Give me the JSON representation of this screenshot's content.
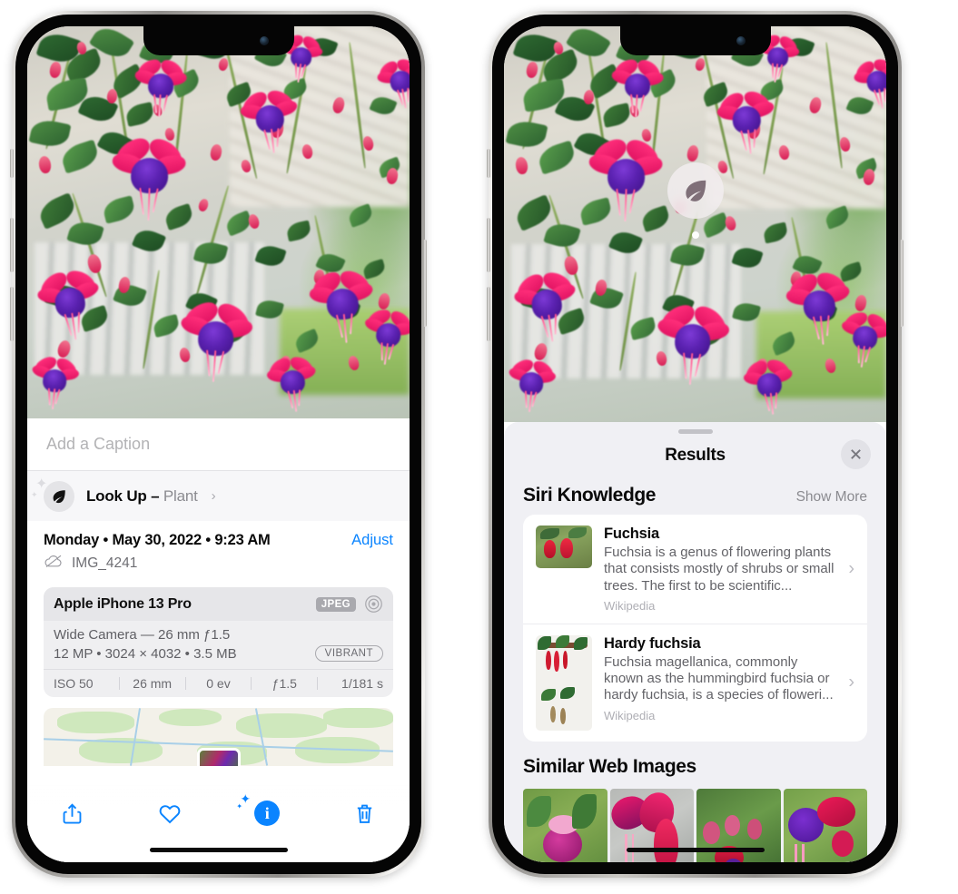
{
  "left_phone": {
    "caption_placeholder": "Add a Caption",
    "lookup": {
      "label": "Look Up – ",
      "category": "Plant",
      "chevron": "›",
      "icon": "leaf-icon"
    },
    "meta": {
      "date": "Monday • May 30, 2022 • 9:23 AM",
      "adjust_label": "Adjust",
      "filename": "IMG_4241",
      "cloud_icon": "icloud-slash-icon"
    },
    "exif": {
      "device": "Apple iPhone 13 Pro",
      "format_badge": "JPEG",
      "lens_icon": "lens-circle-icon",
      "lens_line": "Wide Camera — 26 mm ƒ1.5",
      "size_line": "12 MP • 3024 × 4032 • 3.5 MB",
      "style_badge": "VIBRANT",
      "stats": [
        "ISO 50",
        "26 mm",
        "0 ev",
        "ƒ1.5",
        "1/181 s"
      ]
    },
    "toolbar": {
      "share_label": "Share",
      "favorite_label": "Favorite",
      "info_label": "Info",
      "info_glyph": "i",
      "trash_label": "Delete"
    }
  },
  "right_phone": {
    "pin": {
      "icon": "leaf-icon"
    },
    "sheet": {
      "title": "Results",
      "close_label": "Close",
      "grabber": "drag-handle"
    },
    "siri_knowledge": {
      "heading": "Siri Knowledge",
      "show_more": "Show More",
      "items": [
        {
          "title": "Fuchsia",
          "description": "Fuchsia is a genus of flowering plants that consists mostly of shrubs or small trees. The first to be scientific...",
          "source": "Wikipedia",
          "chevron": "›"
        },
        {
          "title": "Hardy fuchsia",
          "description": "Fuchsia magellanica, commonly known as the hummingbird fuchsia or hardy fuchsia, is a species of floweri...",
          "source": "Wikipedia",
          "chevron": "›"
        }
      ]
    },
    "similar_web_images": {
      "heading": "Similar Web Images",
      "tiles": [
        "fuchsia-thumb-1",
        "fuchsia-thumb-2",
        "fuchsia-thumb-3",
        "fuchsia-thumb-4"
      ]
    }
  },
  "colors": {
    "accent_blue": "#0a84ff",
    "sheet_bg": "#f0f0f4",
    "card_bg": "#ffffff",
    "secondary_text": "#8b8b90"
  }
}
